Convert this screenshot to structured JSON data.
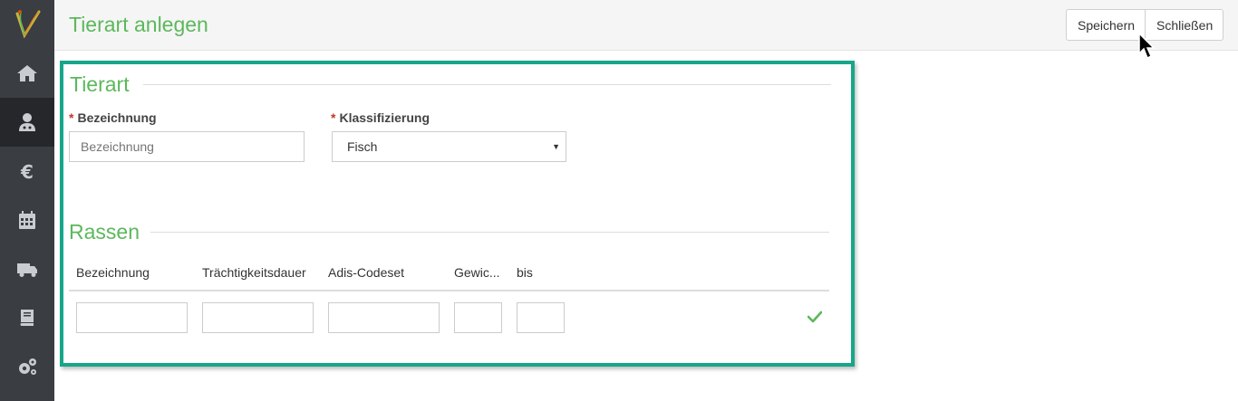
{
  "app": {
    "title": "Tierart anlegen"
  },
  "toolbar": {
    "save_label": "Speichern",
    "close_label": "Schließen"
  },
  "sidebar": {
    "items": [
      {
        "name": "home",
        "icon": "home-icon"
      },
      {
        "name": "doctor",
        "icon": "user-doctor-icon",
        "active": true
      },
      {
        "name": "euro",
        "icon": "euro-icon"
      },
      {
        "name": "calendar",
        "icon": "calendar-icon"
      },
      {
        "name": "truck",
        "icon": "truck-icon"
      },
      {
        "name": "book",
        "icon": "book-icon"
      },
      {
        "name": "settings",
        "icon": "gears-icon"
      }
    ]
  },
  "form": {
    "section_title": "Tierart",
    "bezeichnung": {
      "label": "Bezeichnung",
      "required_mark": "*",
      "placeholder": "Bezeichnung",
      "value": ""
    },
    "klassifizierung": {
      "label": "Klassifizierung",
      "required_mark": "*",
      "value": "Fisch"
    }
  },
  "rassen": {
    "section_title": "Rassen",
    "columns": [
      "Bezeichnung",
      "Trächtigkeitsdauer",
      "Adis-Codeset",
      "Gewic...",
      "bis"
    ]
  },
  "colors": {
    "accent": "#5cb85c",
    "highlight_border": "#16a68a",
    "sidebar": "#3a3d42"
  }
}
